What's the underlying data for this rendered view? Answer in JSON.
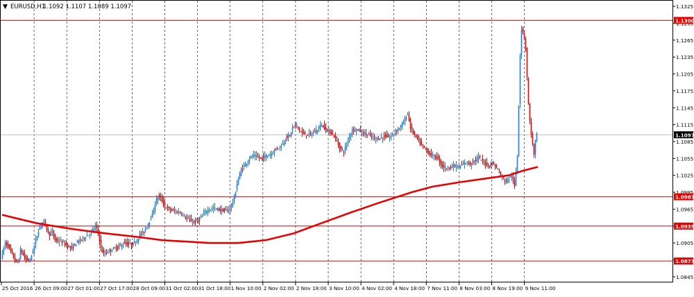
{
  "header": {
    "menu_glyph": "▼",
    "symbol": "EURUSD,H1",
    "ohlc": "1.1092 1.1107 1.1089 1.1097"
  },
  "colors": {
    "background": "#ffffff",
    "frame": "#000000",
    "grid": "#000000",
    "bull_candle": "#1e78e6",
    "bear_candle": "#e60000",
    "moving_average": "#e60000",
    "level_line": "#e60000",
    "current_price_line": "#c0c0c0",
    "tag_text": "#ffffff",
    "current_tag_bg": "#000000"
  },
  "chart_data": {
    "type": "candlestick",
    "symbol": "EURUSD",
    "timeframe": "H1",
    "ylim": [
      1.0835,
      1.1335
    ],
    "grid": "vertical-dashed",
    "y_ticks": [
      "1.1325",
      "1.1295",
      "1.1265",
      "1.1235",
      "1.1205",
      "1.1175",
      "1.1145",
      "1.1115",
      "1.1085",
      "1.1055",
      "1.1025",
      "1.0995",
      "1.0965",
      "1.0935",
      "1.0905",
      "1.0875",
      "1.0845"
    ],
    "x_tick_labels": [
      "25 Oct 2016",
      "26 Oct 09:00",
      "27 Oct 01:00",
      "27 Oct 17:00",
      "28 Oct 09:00",
      "31 Oct 02:00",
      "31 Oct 18:00",
      "1 Nov 10:00",
      "2 Nov 02:00",
      "2 Nov 18:00",
      "3 Nov 10:00",
      "4 Nov 02:00",
      "4 Nov 18:00",
      "7 Nov 11:00",
      "8 Nov 03:00",
      "8 Nov 19:00",
      "9 Nov 11:00"
    ],
    "price_levels": [
      {
        "label": "1.1300",
        "value": 1.13
      },
      {
        "label": "1.0987",
        "value": 1.0987
      },
      {
        "label": "1.0935",
        "value": 1.0935
      },
      {
        "label": "1.0873",
        "value": 1.0873
      }
    ],
    "current_price": {
      "label": "1.1097",
      "value": 1.1097
    },
    "price_path": [
      [
        0,
        1.088
      ],
      [
        6,
        1.0905
      ],
      [
        10,
        1.09
      ],
      [
        16,
        1.0885
      ],
      [
        22,
        1.087
      ],
      [
        26,
        1.0875
      ],
      [
        28,
        1.0893
      ],
      [
        36,
        1.0875
      ],
      [
        42,
        1.0875
      ],
      [
        48,
        1.09
      ],
      [
        54,
        1.0928
      ],
      [
        58,
        1.094
      ],
      [
        62,
        1.0945
      ],
      [
        66,
        1.093
      ],
      [
        70,
        1.092
      ],
      [
        74,
        1.0925
      ],
      [
        78,
        1.091
      ],
      [
        84,
        1.0908
      ],
      [
        90,
        1.0905
      ],
      [
        96,
        1.09
      ],
      [
        102,
        1.0895
      ],
      [
        108,
        1.0905
      ],
      [
        114,
        1.091
      ],
      [
        120,
        1.0915
      ],
      [
        126,
        1.092
      ],
      [
        132,
        1.0927
      ],
      [
        136,
        1.0935
      ],
      [
        140,
        1.0925
      ],
      [
        144,
        1.0895
      ],
      [
        148,
        1.0885
      ],
      [
        154,
        1.089
      ],
      [
        160,
        1.0893
      ],
      [
        166,
        1.0897
      ],
      [
        172,
        1.09
      ],
      [
        178,
        1.0905
      ],
      [
        184,
        1.0903
      ],
      [
        190,
        1.0903
      ],
      [
        196,
        1.091
      ],
      [
        200,
        1.092
      ],
      [
        206,
        1.0925
      ],
      [
        212,
        1.094
      ],
      [
        218,
        1.0955
      ],
      [
        222,
        1.0975
      ],
      [
        226,
        1.0988
      ],
      [
        230,
        1.0985
      ],
      [
        236,
        1.097
      ],
      [
        242,
        1.0965
      ],
      [
        248,
        1.0962
      ],
      [
        254,
        1.096
      ],
      [
        260,
        1.0958
      ],
      [
        266,
        1.095
      ],
      [
        272,
        1.0945
      ],
      [
        278,
        1.0942
      ],
      [
        284,
        1.0945
      ],
      [
        288,
        1.095
      ],
      [
        294,
        1.096
      ],
      [
        300,
        1.0965
      ],
      [
        306,
        1.0967
      ],
      [
        312,
        1.0965
      ],
      [
        318,
        1.0963
      ],
      [
        324,
        1.0962
      ],
      [
        330,
        1.0967
      ],
      [
        336,
        1.0985
      ],
      [
        340,
        1.101
      ],
      [
        346,
        1.1035
      ],
      [
        352,
        1.1045
      ],
      [
        358,
        1.1055
      ],
      [
        364,
        1.106
      ],
      [
        370,
        1.1057
      ],
      [
        376,
        1.1055
      ],
      [
        382,
        1.106
      ],
      [
        388,
        1.1062
      ],
      [
        394,
        1.107
      ],
      [
        400,
        1.1075
      ],
      [
        406,
        1.108
      ],
      [
        410,
        1.1092
      ],
      [
        416,
        1.1095
      ],
      [
        420,
        1.111
      ],
      [
        426,
        1.1115
      ],
      [
        430,
        1.1105
      ],
      [
        434,
        1.11
      ],
      [
        440,
        1.1097
      ],
      [
        446,
        1.1098
      ],
      [
        452,
        1.1102
      ],
      [
        458,
        1.111
      ],
      [
        462,
        1.1115
      ],
      [
        466,
        1.111
      ],
      [
        470,
        1.1105
      ],
      [
        474,
        1.1102
      ],
      [
        478,
        1.1098
      ],
      [
        482,
        1.109
      ],
      [
        486,
        1.108
      ],
      [
        490,
        1.107
      ],
      [
        494,
        1.1068
      ],
      [
        498,
        1.108
      ],
      [
        502,
        1.1095
      ],
      [
        506,
        1.1105
      ],
      [
        510,
        1.1107
      ],
      [
        516,
        1.1105
      ],
      [
        522,
        1.11
      ],
      [
        526,
        1.1098
      ],
      [
        530,
        1.1097
      ],
      [
        536,
        1.1092
      ],
      [
        542,
        1.109
      ],
      [
        548,
        1.1092
      ],
      [
        554,
        1.1095
      ],
      [
        560,
        1.1092
      ],
      [
        566,
        1.11
      ],
      [
        570,
        1.1105
      ],
      [
        574,
        1.111
      ],
      [
        578,
        1.1115
      ],
      [
        582,
        1.1125
      ],
      [
        586,
        1.1135
      ],
      [
        590,
        1.111
      ],
      [
        594,
        1.11
      ],
      [
        598,
        1.1095
      ],
      [
        602,
        1.1085
      ],
      [
        606,
        1.1078
      ],
      [
        610,
        1.1073
      ],
      [
        614,
        1.1068
      ],
      [
        618,
        1.1063
      ],
      [
        622,
        1.106
      ],
      [
        626,
        1.1058
      ],
      [
        630,
        1.1055
      ],
      [
        634,
        1.1045
      ],
      [
        638,
        1.104
      ],
      [
        642,
        1.1038
      ],
      [
        646,
        1.104
      ],
      [
        650,
        1.1041
      ],
      [
        654,
        1.1042
      ],
      [
        658,
        1.104
      ],
      [
        664,
        1.1042
      ],
      [
        668,
        1.1048
      ],
      [
        672,
        1.1048
      ],
      [
        676,
        1.1045
      ],
      [
        680,
        1.105
      ],
      [
        684,
        1.1052
      ],
      [
        688,
        1.1057
      ],
      [
        692,
        1.1052
      ],
      [
        696,
        1.1048
      ],
      [
        700,
        1.1045
      ],
      [
        704,
        1.1043
      ],
      [
        708,
        1.1047
      ],
      [
        712,
        1.1042
      ],
      [
        716,
        1.1035
      ],
      [
        720,
        1.1025
      ],
      [
        724,
        1.1018
      ],
      [
        728,
        1.1015
      ],
      [
        732,
        1.102
      ],
      [
        736,
        1.1025
      ],
      [
        740,
        1.1005
      ],
      [
        744,
        1.106
      ],
      [
        746,
        1.115
      ],
      [
        748,
        1.124
      ],
      [
        750,
        1.1285
      ],
      [
        752,
        1.128
      ],
      [
        754,
        1.127
      ],
      [
        756,
        1.125
      ],
      [
        758,
        1.12
      ],
      [
        760,
        1.115
      ],
      [
        762,
        1.112
      ],
      [
        764,
        1.11
      ],
      [
        766,
        1.108
      ],
      [
        768,
        1.106
      ],
      [
        770,
        1.1085
      ],
      [
        772,
        1.1097
      ]
    ],
    "moving_average": [
      [
        0,
        1.0955
      ],
      [
        50,
        1.094
      ],
      [
        100,
        1.093
      ],
      [
        150,
        1.0922
      ],
      [
        200,
        1.0915
      ],
      [
        230,
        1.091
      ],
      [
        300,
        1.0905
      ],
      [
        340,
        1.0905
      ],
      [
        380,
        1.091
      ],
      [
        420,
        1.0922
      ],
      [
        460,
        1.094
      ],
      [
        500,
        1.0958
      ],
      [
        540,
        1.0975
      ],
      [
        590,
        1.0995
      ],
      [
        620,
        1.1005
      ],
      [
        660,
        1.1013
      ],
      [
        700,
        1.102
      ],
      [
        730,
        1.1025
      ],
      [
        750,
        1.1033
      ],
      [
        772,
        1.104
      ]
    ]
  }
}
